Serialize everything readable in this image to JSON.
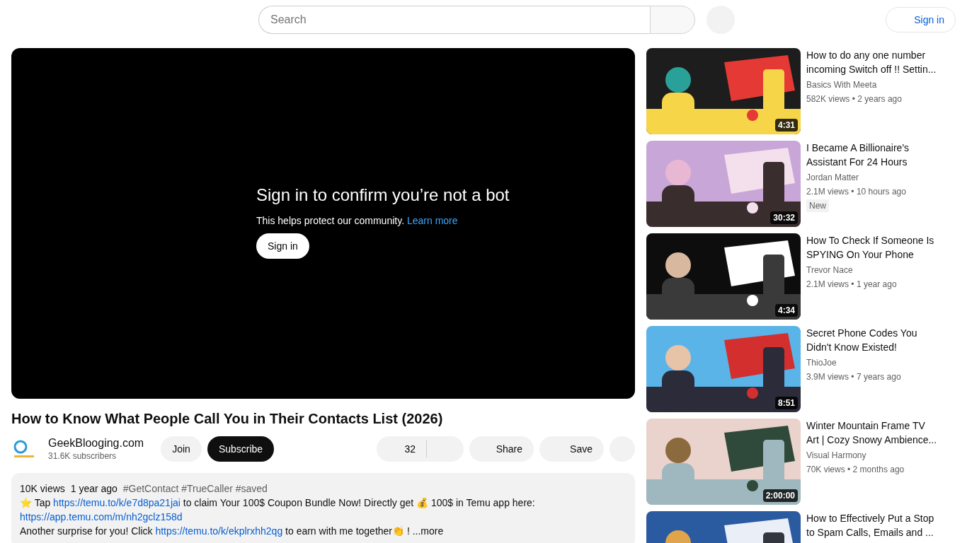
{
  "header": {
    "search": {
      "placeholder": "Search"
    },
    "sign_in": "Sign in"
  },
  "player": {
    "title": "Sign in to confirm you’re not a bot",
    "message": "This helps protect our community.",
    "learn_more": "Learn more",
    "sign_in": "Sign in"
  },
  "video": {
    "title": "How to Know What People Call You in Their Contacts List (2026)",
    "channel": "GeekBlooging.com",
    "subscribers": "31.6K subscribers",
    "join": "Join",
    "subscribe": "Subscribe",
    "likes": "32",
    "share": "Share",
    "save": "Save"
  },
  "description": {
    "views": "10K views",
    "age": "1 year ago",
    "tags": "#GetContact #TrueCaller #saved",
    "lines": [
      [
        {
          "kind": "text",
          "text": "⭐ Tap "
        },
        {
          "kind": "link",
          "text": "https://temu.to/k/e7d8pa21jai"
        },
        {
          "kind": "text",
          "text": " to claim Your 100$ Coupon Bundle Now! Directly get 💰 100$ in Temu app here:"
        }
      ],
      [
        {
          "kind": "link",
          "text": "https://app.temu.com/m/nh2gclz158d"
        }
      ],
      [
        {
          "kind": "text",
          "text": "Another surprise for you! Click "
        },
        {
          "kind": "link",
          "text": "https://temu.to/k/ekplrxhh2qg"
        },
        {
          "kind": "text",
          "text": " to earn with me together👏 ! "
        }
      ]
    ],
    "more": "...more"
  },
  "related": [
    {
      "title": "How to do any one number incoming Switch off !! Settin...",
      "channel": "Basics With Meeta",
      "meta": "582K views • 2 years ago",
      "duration": "4:31"
    },
    {
      "title": "I Became A Billionaire's Assistant For 24 Hours",
      "channel": "Jordan Matter",
      "meta": "2.1M views • 10 hours ago",
      "duration": "30:32",
      "badge": "New"
    },
    {
      "title": "How To Check If Someone Is SPYING On Your Phone",
      "channel": "Trevor Nace",
      "meta": "2.1M views • 1 year ago",
      "duration": "4:34"
    },
    {
      "title": "Secret Phone Codes You Didn't Know Existed!",
      "channel": "ThioJoe",
      "meta": "3.9M views • 7 years ago",
      "duration": "8:51"
    },
    {
      "title": "Winter Mountain Frame TV Art | Cozy Snowy Ambience...",
      "channel": "Visual Harmony",
      "meta": "70K views • 2 months ago",
      "duration": "2:00:00"
    },
    {
      "title": "How to Effectively Put a Stop to Spam Calls, Emails and ..."
    }
  ]
}
